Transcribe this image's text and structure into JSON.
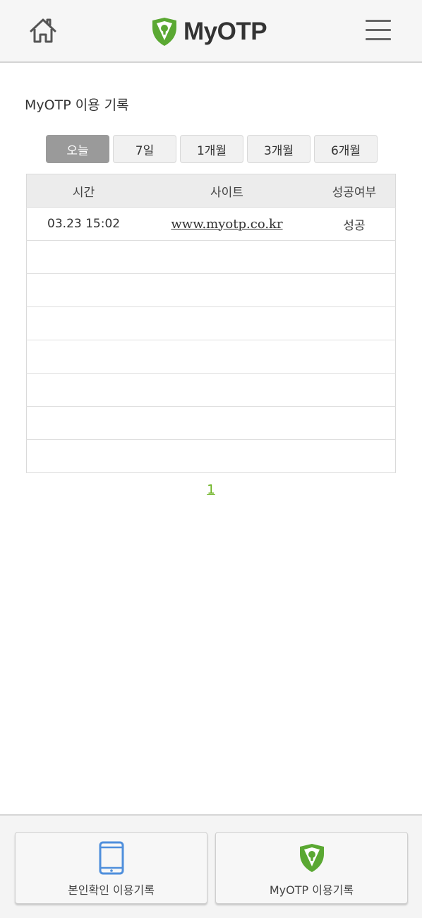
{
  "header": {
    "logo_text": "MyOTP",
    "home_icon": "home-icon",
    "menu_icon": "hamburger-menu-icon",
    "brand_color": "#5aa832"
  },
  "page": {
    "title": "MyOTP 이용 기록"
  },
  "period_tabs": [
    {
      "label": "오늘",
      "active": true
    },
    {
      "label": "7일",
      "active": false
    },
    {
      "label": "1개월",
      "active": false
    },
    {
      "label": "3개월",
      "active": false
    },
    {
      "label": "6개월",
      "active": false
    }
  ],
  "table": {
    "headers": [
      "시간",
      "사이트",
      "성공여부"
    ],
    "rows": [
      {
        "time": "03.23 15:02",
        "site": "www.myotp.co.kr",
        "result": "성공"
      }
    ],
    "empty_rows": 7
  },
  "pagination": {
    "current_page": "1"
  },
  "footer": {
    "left_label": "본인확인 이용기록",
    "left_icon": "tablet-icon",
    "right_label": "MyOTP 이용기록",
    "right_icon": "myotp-shield-icon",
    "accent_blue": "#4f8fdc"
  }
}
